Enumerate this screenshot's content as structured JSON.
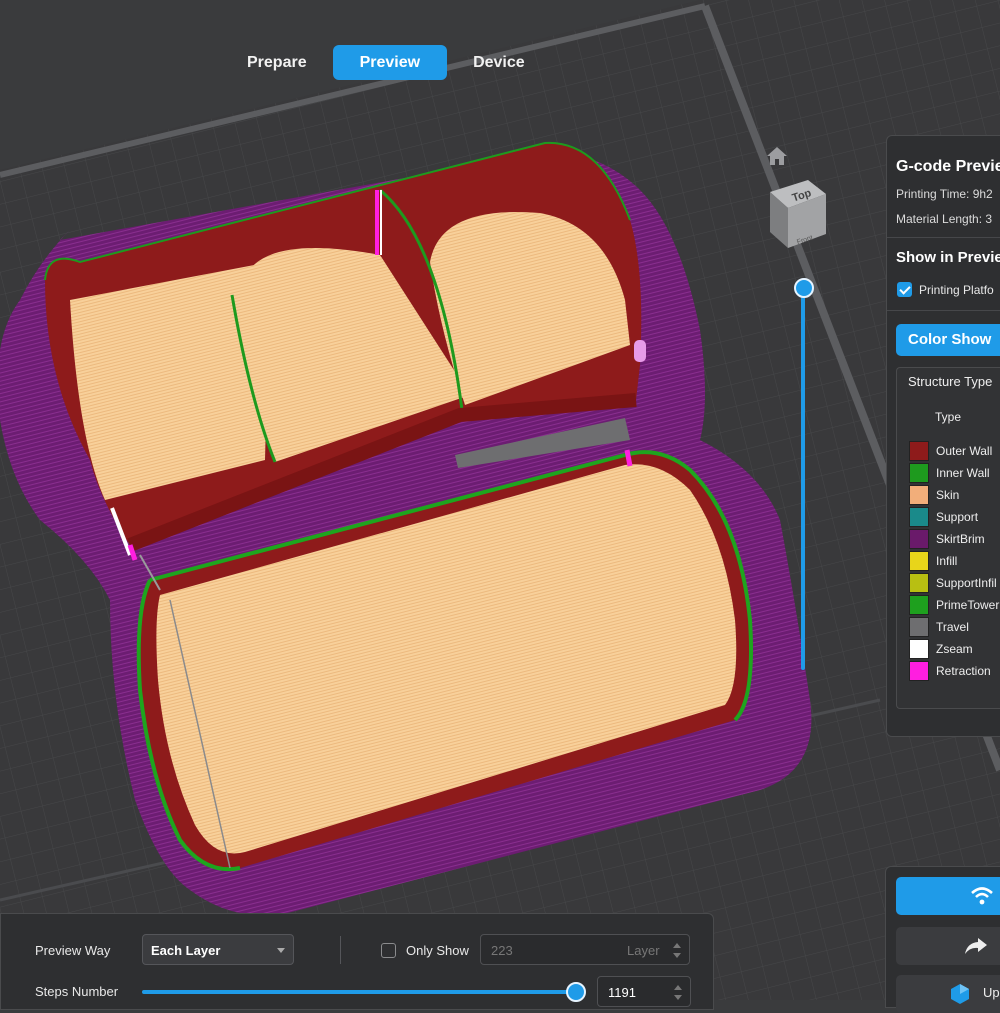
{
  "tabs": [
    {
      "label": "Prepare",
      "active": false
    },
    {
      "label": "Preview",
      "active": true
    },
    {
      "label": "Device",
      "active": false
    }
  ],
  "nav_cube": {
    "top_label": "Top",
    "front_label": "Front"
  },
  "gcode_panel": {
    "title": "G-code Previe",
    "printing_time": "Printing Time: 9h2",
    "material_length": "Material Length: 3",
    "show_in_preview": "Show in Previe",
    "printing_platform_label": "Printing Platfo",
    "printing_platform_checked": true,
    "color_show_label": "Color Show",
    "structure_type_label": "Structure Type",
    "type_header": "Type",
    "legend": [
      {
        "label": "Outer Wall",
        "color": "#8e1b1b"
      },
      {
        "label": "Inner Wall",
        "color": "#1e9a1e"
      },
      {
        "label": "Skin",
        "color": "#f2ae7a"
      },
      {
        "label": "Support",
        "color": "#1a8a8a"
      },
      {
        "label": "SkirtBrim",
        "color": "#6a1a6a"
      },
      {
        "label": "Infill",
        "color": "#e8d51a"
      },
      {
        "label": "SupportInfil",
        "color": "#b8bf12"
      },
      {
        "label": "PrimeTower",
        "color": "#1ea01e"
      },
      {
        "label": "Travel",
        "color": "#6e6e70"
      },
      {
        "label": "Zseam",
        "color": "#ffffff"
      },
      {
        "label": "Retraction",
        "color": "#ff1ee0"
      }
    ]
  },
  "bottom_panel": {
    "preview_way_label": "Preview Way",
    "preview_way_value": "Each Layer",
    "only_show_label": "Only Show",
    "only_show_checked": false,
    "layer_value": "223",
    "layer_unit": "Layer",
    "steps_label": "Steps Number",
    "steps_value": "1191",
    "steps_fraction": 1.0
  },
  "layer_slider": {
    "fraction": 1.0
  },
  "actions": {
    "upload_label": "Uplo"
  },
  "colors": {
    "accent": "#1f9be8",
    "brim": "#6a1a6a",
    "outer_wall": "#8e1b1b",
    "skin": "#f6cb93"
  }
}
